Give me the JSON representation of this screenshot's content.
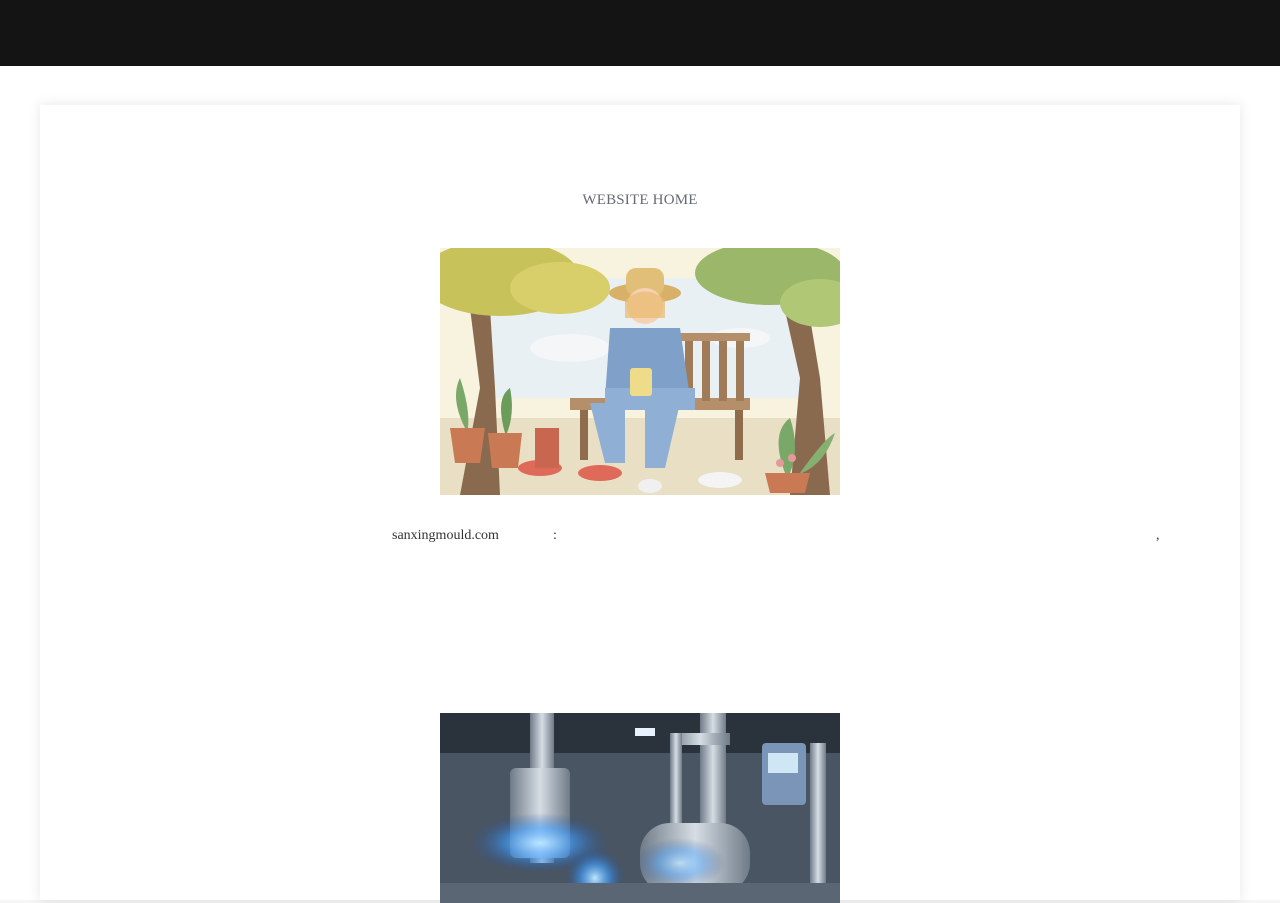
{
  "header": {
    "background_color": "#141414"
  },
  "nav": {
    "home_label": "WEBSITE HOME"
  },
  "hero_image": {
    "alt": "Illustration of a person in a denim jacket and straw hat sitting on a wooden garden bench holding a cup, surrounded by trees and potted plants"
  },
  "caption": {
    "site": "sanxingmould.com",
    "colon": ":",
    "comma": ","
  },
  "second_image": {
    "alt": "Industrial stainless steel pipes and pump machinery with glowing blue light in a factory"
  },
  "colors": {
    "nav_text": "#666a73",
    "body_text": "#333333",
    "card_bg": "#ffffff"
  }
}
